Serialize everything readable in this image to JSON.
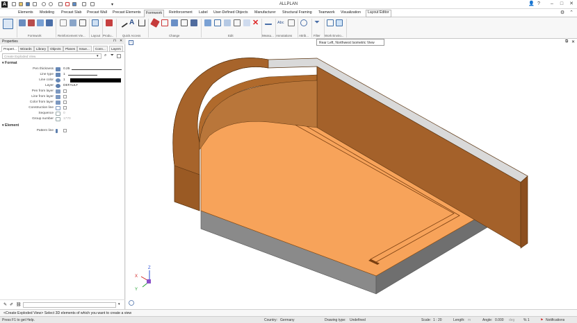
{
  "app_title": "ALLPLAN",
  "tabs": [
    "Elements",
    "Modeling",
    "Precast Slab",
    "Precast Wall",
    "Precast Elements",
    "Formwork",
    "Reinforcement",
    "Label",
    "User-Defined Objects",
    "Manufacturer",
    "Structural Framing",
    "Teamwork",
    "Visualization",
    "Layout Editor"
  ],
  "active_tab": "Formwork",
  "ribbon_groups": [
    "Formwork",
    "Reinforcement Vie...",
    "Layout",
    "Produ...",
    "Quick Access",
    "Change",
    "Edit",
    "Measu...",
    "Annotations",
    "Attrib...",
    "Filter",
    "Work Enviro..."
  ],
  "tooltip": "Rear Left, Northwest Isometric View",
  "properties": {
    "title": "Properties",
    "tabs": [
      "Propert...",
      "Wizards",
      "Library",
      "Objects",
      "Planes",
      "Issue...",
      "Conn...",
      "Layers"
    ],
    "search_placeholder": "Create Exploded View",
    "format_header": "Format",
    "element_header": "Element",
    "rows": [
      {
        "label": "Pen thickness",
        "value": "0.25"
      },
      {
        "label": "Line type",
        "value": "1"
      },
      {
        "label": "Line color",
        "value": "1"
      },
      {
        "label": "Layer",
        "value": "DEFAULT"
      },
      {
        "label": "Pen from layer",
        "value": ""
      },
      {
        "label": "Line from layer",
        "value": ""
      },
      {
        "label": "Color from layer",
        "value": ""
      },
      {
        "label": "Construction line",
        "value": ""
      },
      {
        "label": "Sequence",
        "value": "0"
      },
      {
        "label": "Group number",
        "value": "1770"
      }
    ],
    "element_rows": [
      {
        "label": "Pattern line",
        "value": ""
      }
    ]
  },
  "axis": {
    "x": "X",
    "y": "Y",
    "z": "Z"
  },
  "command_prompt": "<Create Exploded View> Select 3D elements of which you want to create a view",
  "status": {
    "help": "Press F1 to get Help.",
    "country_label": "Country:",
    "country": "Germany",
    "drawing_type_label": "Drawing type:",
    "drawing_type": "Undefined",
    "scale_label": "Scale:",
    "scale": "1 : 20",
    "length_label": "Length:",
    "length": "m",
    "angle_label": "Angle:",
    "angle": "0.000",
    "angle_unit": "deg",
    "percent": "% 1",
    "notifications": "Notifications"
  }
}
